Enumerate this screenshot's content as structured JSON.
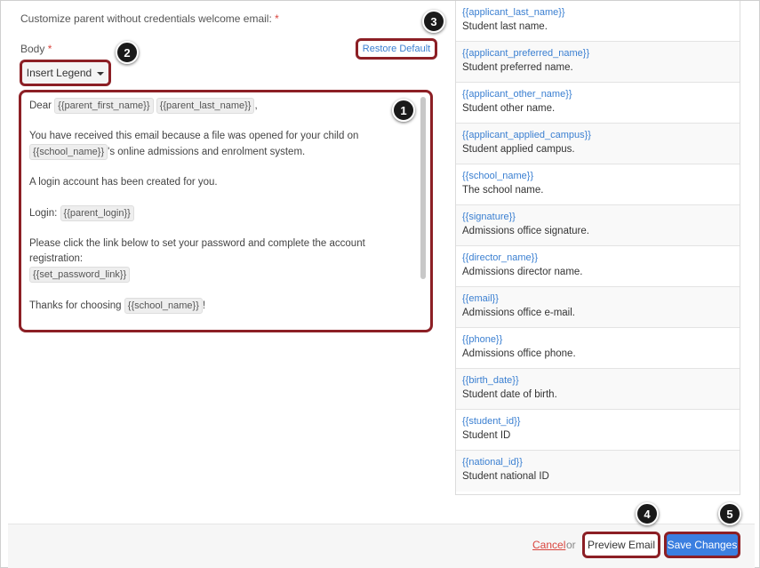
{
  "form": {
    "customize_label": "Customize parent without credentials welcome email:",
    "required_mark": "*",
    "body_label": "Body",
    "restore_default": "Restore Default",
    "insert_legend": "Insert Legend"
  },
  "email_body": {
    "dear": "Dear",
    "parent_first_name": "{{parent_first_name}}",
    "parent_last_name": "{{parent_last_name}}",
    "comma": ",",
    "line1": "You have received this email because a file was opened for your child on",
    "school_name": "{{school_name}}",
    "line1b": "'s online admissions and enrolment system.",
    "line2": "A login account has been created for you.",
    "login_label": "Login:",
    "parent_login": "{{parent_login}}",
    "line3": "Please click the link below to set your password and complete the account registration:",
    "set_password_link": "{{set_password_link}}",
    "thanks": "Thanks for choosing",
    "exclaim": "!"
  },
  "legend": [
    {
      "code": "{{applicant_last_name}}",
      "desc": "Student last name."
    },
    {
      "code": "{{applicant_preferred_name}}",
      "desc": "Student preferred name."
    },
    {
      "code": "{{applicant_other_name}}",
      "desc": "Student other name."
    },
    {
      "code": "{{applicant_applied_campus}}",
      "desc": "Student applied campus."
    },
    {
      "code": "{{school_name}}",
      "desc": "The school name."
    },
    {
      "code": "{{signature}}",
      "desc": "Admissions office signature."
    },
    {
      "code": "{{director_name}}",
      "desc": "Admissions director name."
    },
    {
      "code": "{{email}}",
      "desc": "Admissions office e-mail."
    },
    {
      "code": "{{phone}}",
      "desc": "Admissions office phone."
    },
    {
      "code": "{{birth_date}}",
      "desc": "Student date of birth."
    },
    {
      "code": "{{student_id}}",
      "desc": "Student ID"
    },
    {
      "code": "{{national_id}}",
      "desc": "Student national ID"
    }
  ],
  "footer": {
    "cancel": "Cancel",
    "or": "or",
    "preview": "Preview Email",
    "save": "Save Changes"
  },
  "badges": [
    "1",
    "2",
    "3",
    "4",
    "5"
  ],
  "colors": {
    "accent": "#3b7fe0",
    "link": "#3a7fd1",
    "highlight_border": "#8c1f25",
    "required": "#d9443d"
  }
}
